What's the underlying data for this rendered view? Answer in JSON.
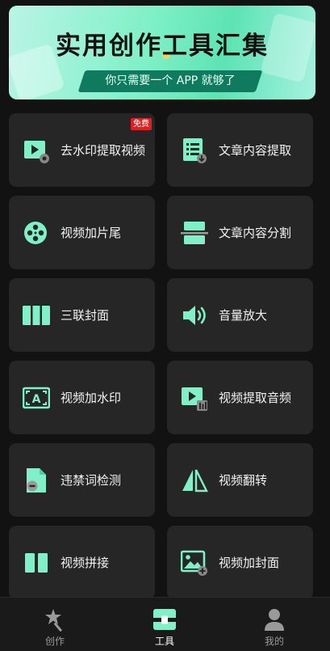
{
  "banner": {
    "title": "实用创作工具汇集",
    "subtitle": "你只需要一个 APP 就够了"
  },
  "tools": [
    {
      "label": "去水印提取视频",
      "icon": "video-watermark-icon",
      "badge": "免费"
    },
    {
      "label": "文章内容提取",
      "icon": "document-extract-icon"
    },
    {
      "label": "视频加片尾",
      "icon": "film-reel-icon"
    },
    {
      "label": "文章内容分割",
      "icon": "document-split-icon"
    },
    {
      "label": "三联封面",
      "icon": "triple-cover-icon"
    },
    {
      "label": "音量放大",
      "icon": "speaker-icon"
    },
    {
      "label": "视频加水印",
      "icon": "add-watermark-icon"
    },
    {
      "label": "视频提取音频",
      "icon": "audio-extract-icon"
    },
    {
      "label": "违禁词检测",
      "icon": "word-check-icon"
    },
    {
      "label": "视频翻转",
      "icon": "flip-icon"
    },
    {
      "label": "视频拼接",
      "icon": "video-splice-icon"
    },
    {
      "label": "视频加封面",
      "icon": "add-cover-icon"
    }
  ],
  "tabbar": {
    "tabs": [
      {
        "label": "创作",
        "icon": "star-wand-icon",
        "active": false
      },
      {
        "label": "工具",
        "icon": "toolbox-icon",
        "active": true
      },
      {
        "label": "我的",
        "icon": "person-icon",
        "active": false
      }
    ]
  },
  "colors": {
    "accent": "#7ff0c8",
    "card_bg": "#262626",
    "page_bg": "#121212",
    "badge": "#e02020"
  }
}
